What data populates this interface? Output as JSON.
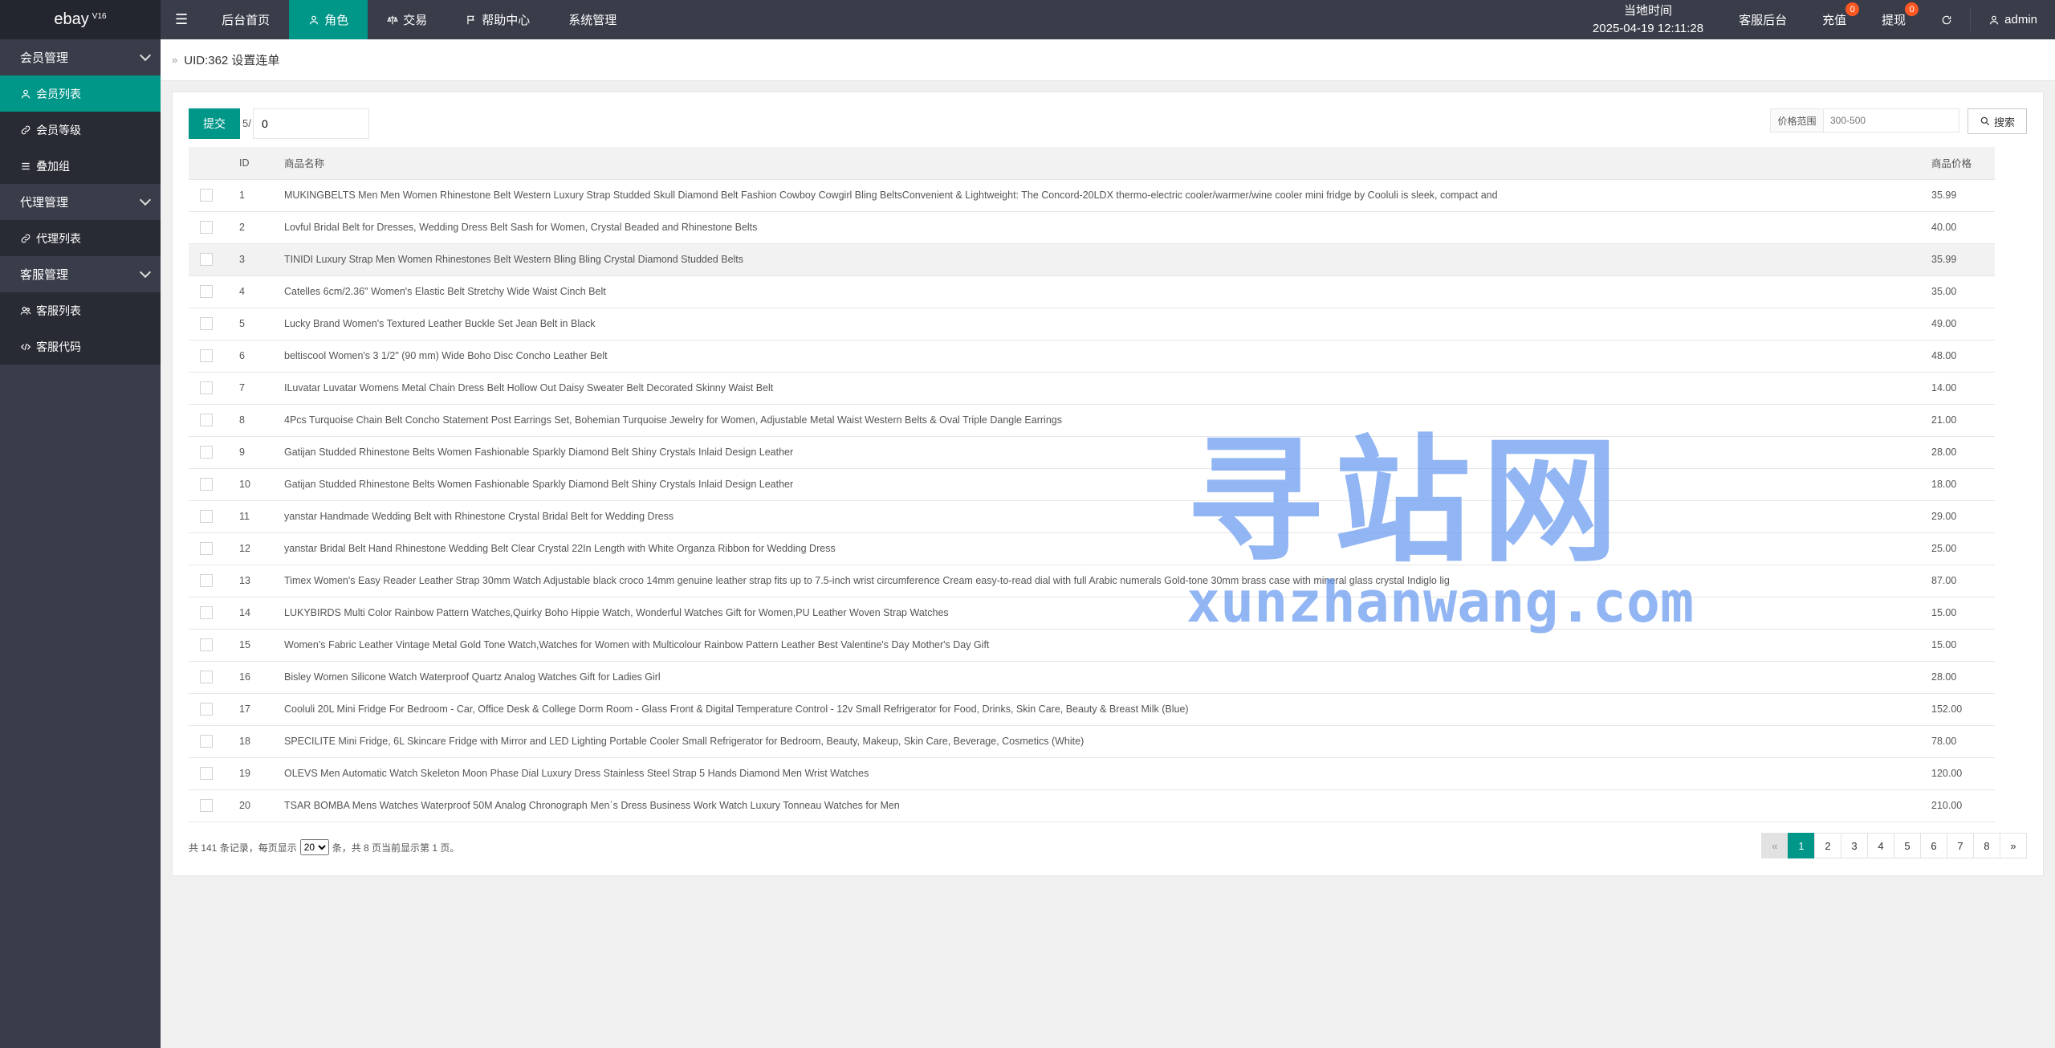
{
  "brand": {
    "name": "ebay",
    "version": "V16"
  },
  "topnav": {
    "items": [
      {
        "label": "后台首页"
      },
      {
        "label": "角色"
      },
      {
        "label": "交易"
      },
      {
        "label": "帮助中心"
      },
      {
        "label": "系统管理"
      }
    ],
    "active_index": 1
  },
  "header_right": {
    "time_label": "当地时间",
    "time_value": "2025-04-19 12:11:28",
    "service_label": "客服后台",
    "recharge_label": "充值",
    "recharge_badge": "0",
    "withdraw_label": "提现",
    "withdraw_badge": "0",
    "user": "admin"
  },
  "sidebar": {
    "groups": [
      {
        "label": "会员管理",
        "items": [
          {
            "label": "会员列表",
            "icon": "user-icon"
          },
          {
            "label": "会员等级",
            "icon": "link-icon"
          },
          {
            "label": "叠加组",
            "icon": "list-icon"
          }
        ]
      },
      {
        "label": "代理管理",
        "items": [
          {
            "label": "代理列表",
            "icon": "link-icon"
          }
        ]
      },
      {
        "label": "客服管理",
        "items": [
          {
            "label": "客服列表",
            "icon": "users-icon"
          },
          {
            "label": "客服代码",
            "icon": "code-icon"
          }
        ]
      }
    ]
  },
  "breadcrumb": {
    "text": "UID:362 设置连单"
  },
  "toolbar": {
    "submit_label": "提交",
    "page_prefix": "5/",
    "page_value": "0",
    "price_label": "价格范围",
    "price_placeholder": "300-500",
    "search_label": "搜索"
  },
  "table": {
    "headers": {
      "id": "ID",
      "name": "商品名称",
      "price": "商品价格"
    },
    "rows": [
      {
        "id": "1",
        "name": "MUKINGBELTS Men Men Women Rhinestone Belt Western Luxury Strap Studded Skull Diamond Belt Fashion Cowboy Cowgirl Bling BeltsConvenient & Lightweight: The Concord-20LDX thermo-electric cooler/warmer/wine cooler mini fridge by Cooluli is sleek, compact and",
        "price": "35.99"
      },
      {
        "id": "2",
        "name": "Lovful Bridal Belt for Dresses, Wedding Dress Belt Sash for Women, Crystal Beaded and Rhinestone Belts",
        "price": "40.00"
      },
      {
        "id": "3",
        "name": "TINIDI Luxury Strap Men Women Rhinestones Belt Western Bling Bling Crystal Diamond Studded Belts",
        "price": "35.99"
      },
      {
        "id": "4",
        "name": "Catelles 6cm/2.36\" Women's Elastic Belt Stretchy Wide Waist Cinch Belt",
        "price": "35.00"
      },
      {
        "id": "5",
        "name": "Lucky Brand Women's Textured Leather Buckle Set Jean Belt in Black",
        "price": "49.00"
      },
      {
        "id": "6",
        "name": "beltiscool Women's 3 1/2\" (90 mm) Wide Boho Disc Concho Leather Belt",
        "price": "48.00"
      },
      {
        "id": "7",
        "name": "ILuvatar Luvatar Womens Metal Chain Dress Belt Hollow Out Daisy Sweater Belt Decorated Skinny Waist Belt",
        "price": "14.00"
      },
      {
        "id": "8",
        "name": "4Pcs Turquoise Chain Belt Concho Statement Post Earrings Set, Bohemian Turquoise Jewelry for Women, Adjustable Metal Waist Western Belts & Oval Triple Dangle Earrings",
        "price": "21.00"
      },
      {
        "id": "9",
        "name": "Gatijan Studded Rhinestone Belts Women Fashionable Sparkly Diamond Belt Shiny Crystals Inlaid Design Leather",
        "price": "28.00"
      },
      {
        "id": "10",
        "name": "Gatijan Studded Rhinestone Belts Women Fashionable Sparkly Diamond Belt Shiny Crystals Inlaid Design Leather",
        "price": "18.00"
      },
      {
        "id": "11",
        "name": "yanstar Handmade Wedding Belt with Rhinestone Crystal Bridal Belt for Wedding Dress",
        "price": "29.00"
      },
      {
        "id": "12",
        "name": "yanstar Bridal Belt Hand Rhinestone Wedding Belt Clear Crystal 22In Length with White Organza Ribbon for Wedding Dress",
        "price": "25.00"
      },
      {
        "id": "13",
        "name": "Timex Women's Easy Reader Leather Strap 30mm Watch Adjustable black croco 14mm genuine leather strap fits up to 7.5-inch wrist circumference Cream easy-to-read dial with full Arabic numerals Gold-tone 30mm brass case with mineral glass crystal Indiglo lig",
        "price": "87.00"
      },
      {
        "id": "14",
        "name": "LUKYBIRDS Multi Color Rainbow Pattern Watches,Quirky Boho Hippie Watch, Wonderful Watches Gift for Women,PU Leather Woven Strap Watches",
        "price": "15.00"
      },
      {
        "id": "15",
        "name": "Women's Fabric Leather Vintage Metal Gold Tone Watch,Watches for Women with Multicolour Rainbow Pattern Leather Best Valentine's Day Mother's Day Gift",
        "price": "15.00"
      },
      {
        "id": "16",
        "name": "Bisley Women Silicone Watch Waterproof Quartz Analog Watches Gift for Ladies Girl",
        "price": "28.00"
      },
      {
        "id": "17",
        "name": "Cooluli 20L Mini Fridge For Bedroom - Car, Office Desk & College Dorm Room - Glass Front & Digital Temperature Control - 12v Small Refrigerator for Food, Drinks, Skin Care, Beauty & Breast Milk (Blue)",
        "price": "152.00"
      },
      {
        "id": "18",
        "name": "SPECILITE Mini Fridge, 6L Skincare Fridge with Mirror and LED Lighting Portable Cooler Small Refrigerator for Bedroom, Beauty, Makeup, Skin Care, Beverage, Cosmetics (White)",
        "price": "78.00"
      },
      {
        "id": "19",
        "name": "OLEVS Men Automatic Watch Skeleton Moon Phase Dial Luxury Dress Stainless Steel Strap 5 Hands Diamond Men Wrist Watches",
        "price": "120.00"
      },
      {
        "id": "20",
        "name": "TSAR BOMBA Mens Watches Waterproof 50M Analog Chronograph Men΄s Dress Business Work Watch Luxury Tonneau Watches for Men",
        "price": "210.00"
      }
    ],
    "highlighted_row": 3
  },
  "footer": {
    "text_before": "共 141 条记录，每页显示",
    "per_page": "20",
    "text_after": "条，共 8 页当前显示第 1 页。"
  },
  "pagination": {
    "prev": "«",
    "next": "»",
    "pages": [
      "1",
      "2",
      "3",
      "4",
      "5",
      "6",
      "7",
      "8"
    ],
    "current": "1"
  },
  "watermark": {
    "cn": "寻站网",
    "en": "xunzhanwang.com"
  },
  "colors": {
    "accent": "#009688",
    "header": "#393d49",
    "badge": "#ff5722"
  }
}
